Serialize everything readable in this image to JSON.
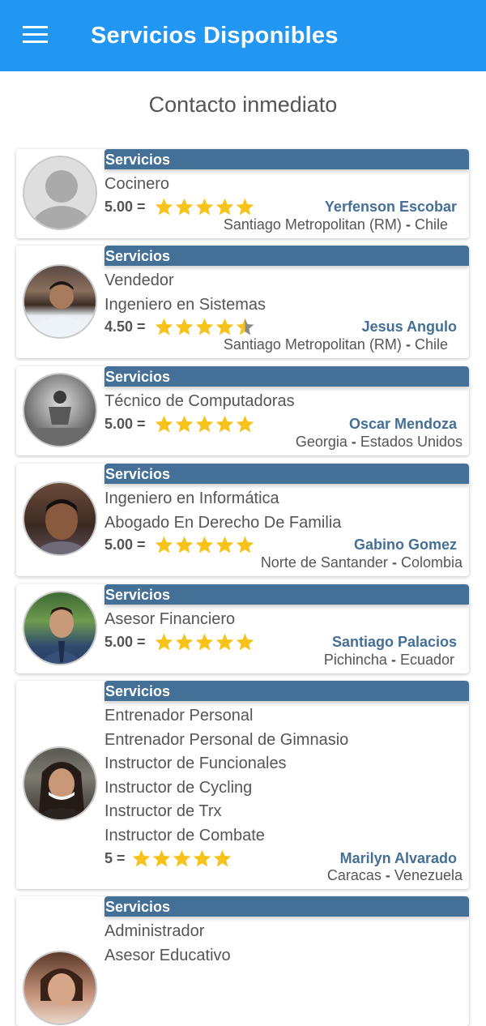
{
  "appbar": {
    "title": "Servicios Disponibles"
  },
  "section": {
    "title": "Contacto inmediato"
  },
  "colors": {
    "appbar": "#2196f3",
    "band": "#446f96",
    "star": "#f7c31b"
  },
  "providers": [
    {
      "band": "Servicios",
      "services": [
        "Cocinero"
      ],
      "score": "5.00 =",
      "rating": 5,
      "name": "Yerfenson Escobar",
      "region": "Santiago Metropolitan (RM)",
      "dash": "-",
      "country": "Chile"
    },
    {
      "band": "Servicios",
      "services": [
        "Vendedor",
        "Ingeniero en Sistemas"
      ],
      "score": "4.50 =",
      "rating": 4.5,
      "name": "Jesus Angulo",
      "region": "Santiago Metropolitan (RM)",
      "dash": "-",
      "country": "Chile"
    },
    {
      "band": "Servicios",
      "services": [
        "Técnico de Computadoras"
      ],
      "score": "5.00 =",
      "rating": 5,
      "name": "Oscar Mendoza",
      "region": "Georgia",
      "dash": "-",
      "country": "Estados Unidos"
    },
    {
      "band": "Servicios",
      "services": [
        "Ingeniero en Informática",
        "Abogado En Derecho De Familia"
      ],
      "score": "5.00 =",
      "rating": 5,
      "name": "Gabino  Gomez",
      "region": "Norte de Santander",
      "dash": "-",
      "country": "Colombia"
    },
    {
      "band": "Servicios",
      "services": [
        "Asesor Financiero"
      ],
      "score": "5.00 =",
      "rating": 5,
      "name": "Santiago  Palacios",
      "region": "Pichincha",
      "dash": "-",
      "country": "Ecuador"
    },
    {
      "band": "Servicios",
      "services": [
        "Entrenador Personal",
        "Entrenador Personal de Gimnasio",
        "Instructor de Funcionales",
        "Instructor de Cycling",
        "Instructor de Trx",
        "Instructor de Combate"
      ],
      "score": "5 =",
      "rating": 5,
      "name": "Marilyn Alvarado",
      "region": "Caracas",
      "dash": "-",
      "country": "Venezuela"
    },
    {
      "band": "Servicios",
      "services": [
        "Administrador",
        "Asesor Educativo"
      ]
    }
  ]
}
